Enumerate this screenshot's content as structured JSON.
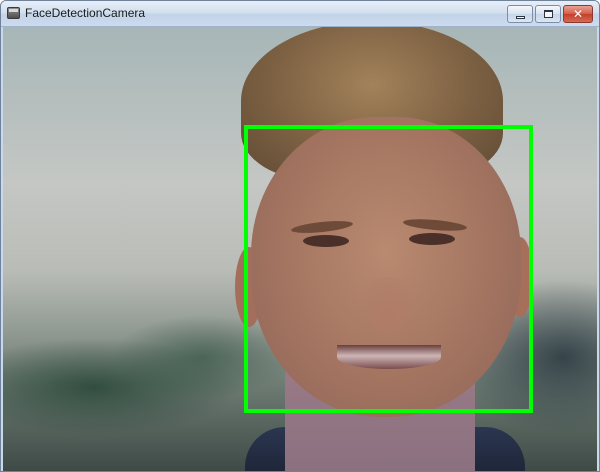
{
  "window": {
    "title": "FaceDetectionCamera",
    "controls": {
      "minimize": "minimize-icon",
      "maximize": "maximize-icon",
      "close_label": "✕"
    }
  },
  "camera_view": {
    "detection_box_color": "#00ff00",
    "detected_faces": 1
  }
}
